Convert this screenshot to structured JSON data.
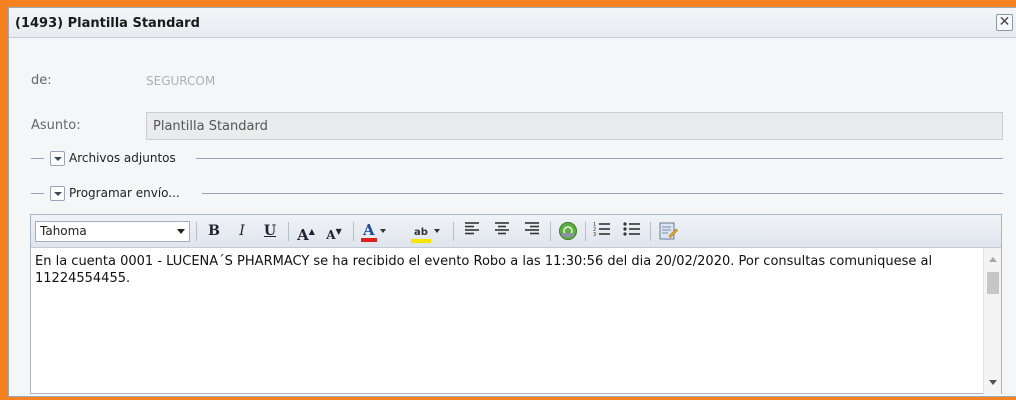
{
  "window": {
    "title": "(1493) Plantilla Standard",
    "close_glyph": "✕"
  },
  "form": {
    "de_label": "de:",
    "de_value": "SEGURCOM",
    "asunto_label": "Asunto:",
    "asunto_value": "Plantilla Standard"
  },
  "sections": {
    "attachments_label": "Archivos adjuntos",
    "schedule_label": "Programar envío..."
  },
  "toolbar": {
    "font_family": "Tahoma",
    "bold": "B",
    "italic": "I",
    "underline": "U",
    "grow_font": "A",
    "shrink_font": "A",
    "font_color": "A",
    "highlight": "ab",
    "icons": [
      "bold-icon",
      "italic-icon",
      "underline-icon",
      "increase-font-icon",
      "decrease-font-icon",
      "font-color-icon",
      "highlight-icon",
      "align-left-icon",
      "align-center-icon",
      "align-right-icon",
      "insert-link-icon",
      "numbered-list-icon",
      "bulleted-list-icon",
      "source-edit-icon"
    ]
  },
  "editor": {
    "text": "En la cuenta 0001 - LUCENA´S PHARMACY se ha recibido el evento Robo a las 11:30:56 del dia 20/02/2020. Por consultas comuniquese al 11224554455."
  },
  "colors": {
    "frame_accent": "#f58220",
    "font_color_bar": "#e02020",
    "highlight_bar": "#f5e400"
  }
}
